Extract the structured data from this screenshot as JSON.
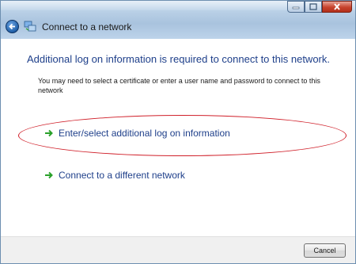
{
  "window": {
    "title": "Connect to a network",
    "controls": {
      "minimize_icon": "minimize-icon",
      "maximize_icon": "maximize-icon",
      "close_icon": "close-icon"
    }
  },
  "main": {
    "heading": "Additional log on information is required to connect to this network.",
    "description": "You may need to select a certificate or enter a user name and password to connect to this network",
    "options": [
      {
        "label": "Enter/select additional log on information",
        "icon": "green-arrow-icon"
      },
      {
        "label": "Connect to a different network",
        "icon": "green-arrow-icon"
      }
    ],
    "highlight_color": "#d0202a"
  },
  "footer": {
    "cancel_label": "Cancel"
  },
  "colors": {
    "heading": "#1e3f8a",
    "link_arrow": "#2aa12a"
  }
}
